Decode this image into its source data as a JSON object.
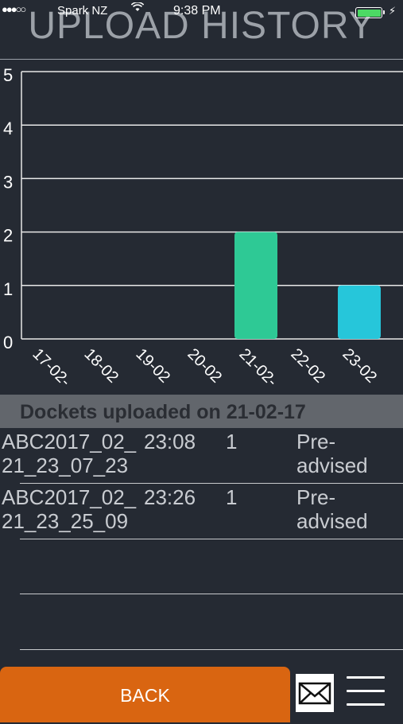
{
  "status_bar": {
    "signal": "●●●○○",
    "carrier": "Spark NZ",
    "time": "9:38 PM",
    "battery_color": "#4cd964",
    "charging_icon": "bolt-icon",
    "wifi_icon": "wifi-icon"
  },
  "header": {
    "title": "UPLOAD HISTORY"
  },
  "chart_data": {
    "type": "bar",
    "categories": [
      "17-02-",
      "18-02",
      "19-02",
      "20-02",
      "21-02-",
      "22-02",
      "23-02"
    ],
    "values": [
      0,
      0,
      0,
      0,
      2,
      0,
      1
    ],
    "bar_colors": [
      "#2ec995",
      "#2ec995",
      "#2ec995",
      "#2ec995",
      "#2ec995",
      "#26c6da",
      "#26c6da"
    ],
    "ylim": [
      0,
      5
    ],
    "yticks": [
      "0",
      "1",
      "2",
      "3",
      "4",
      "5"
    ],
    "grid": true,
    "xlabel": "",
    "ylabel": ""
  },
  "section": {
    "title": "Dockets uploaded on 21-02-17"
  },
  "dockets": [
    {
      "name": "ABC2017_02_ 21_23_07_23",
      "time": "23:08",
      "count": "1",
      "status": "Pre- advised"
    },
    {
      "name": "ABC2017_02_ 21_23_25_09",
      "time": "23:26",
      "count": "1",
      "status": "Pre- advised"
    }
  ],
  "footer": {
    "back_label": "BACK",
    "mail_icon": "mail-icon",
    "menu_icon": "menu-icon",
    "accent_color": "#d96511"
  }
}
